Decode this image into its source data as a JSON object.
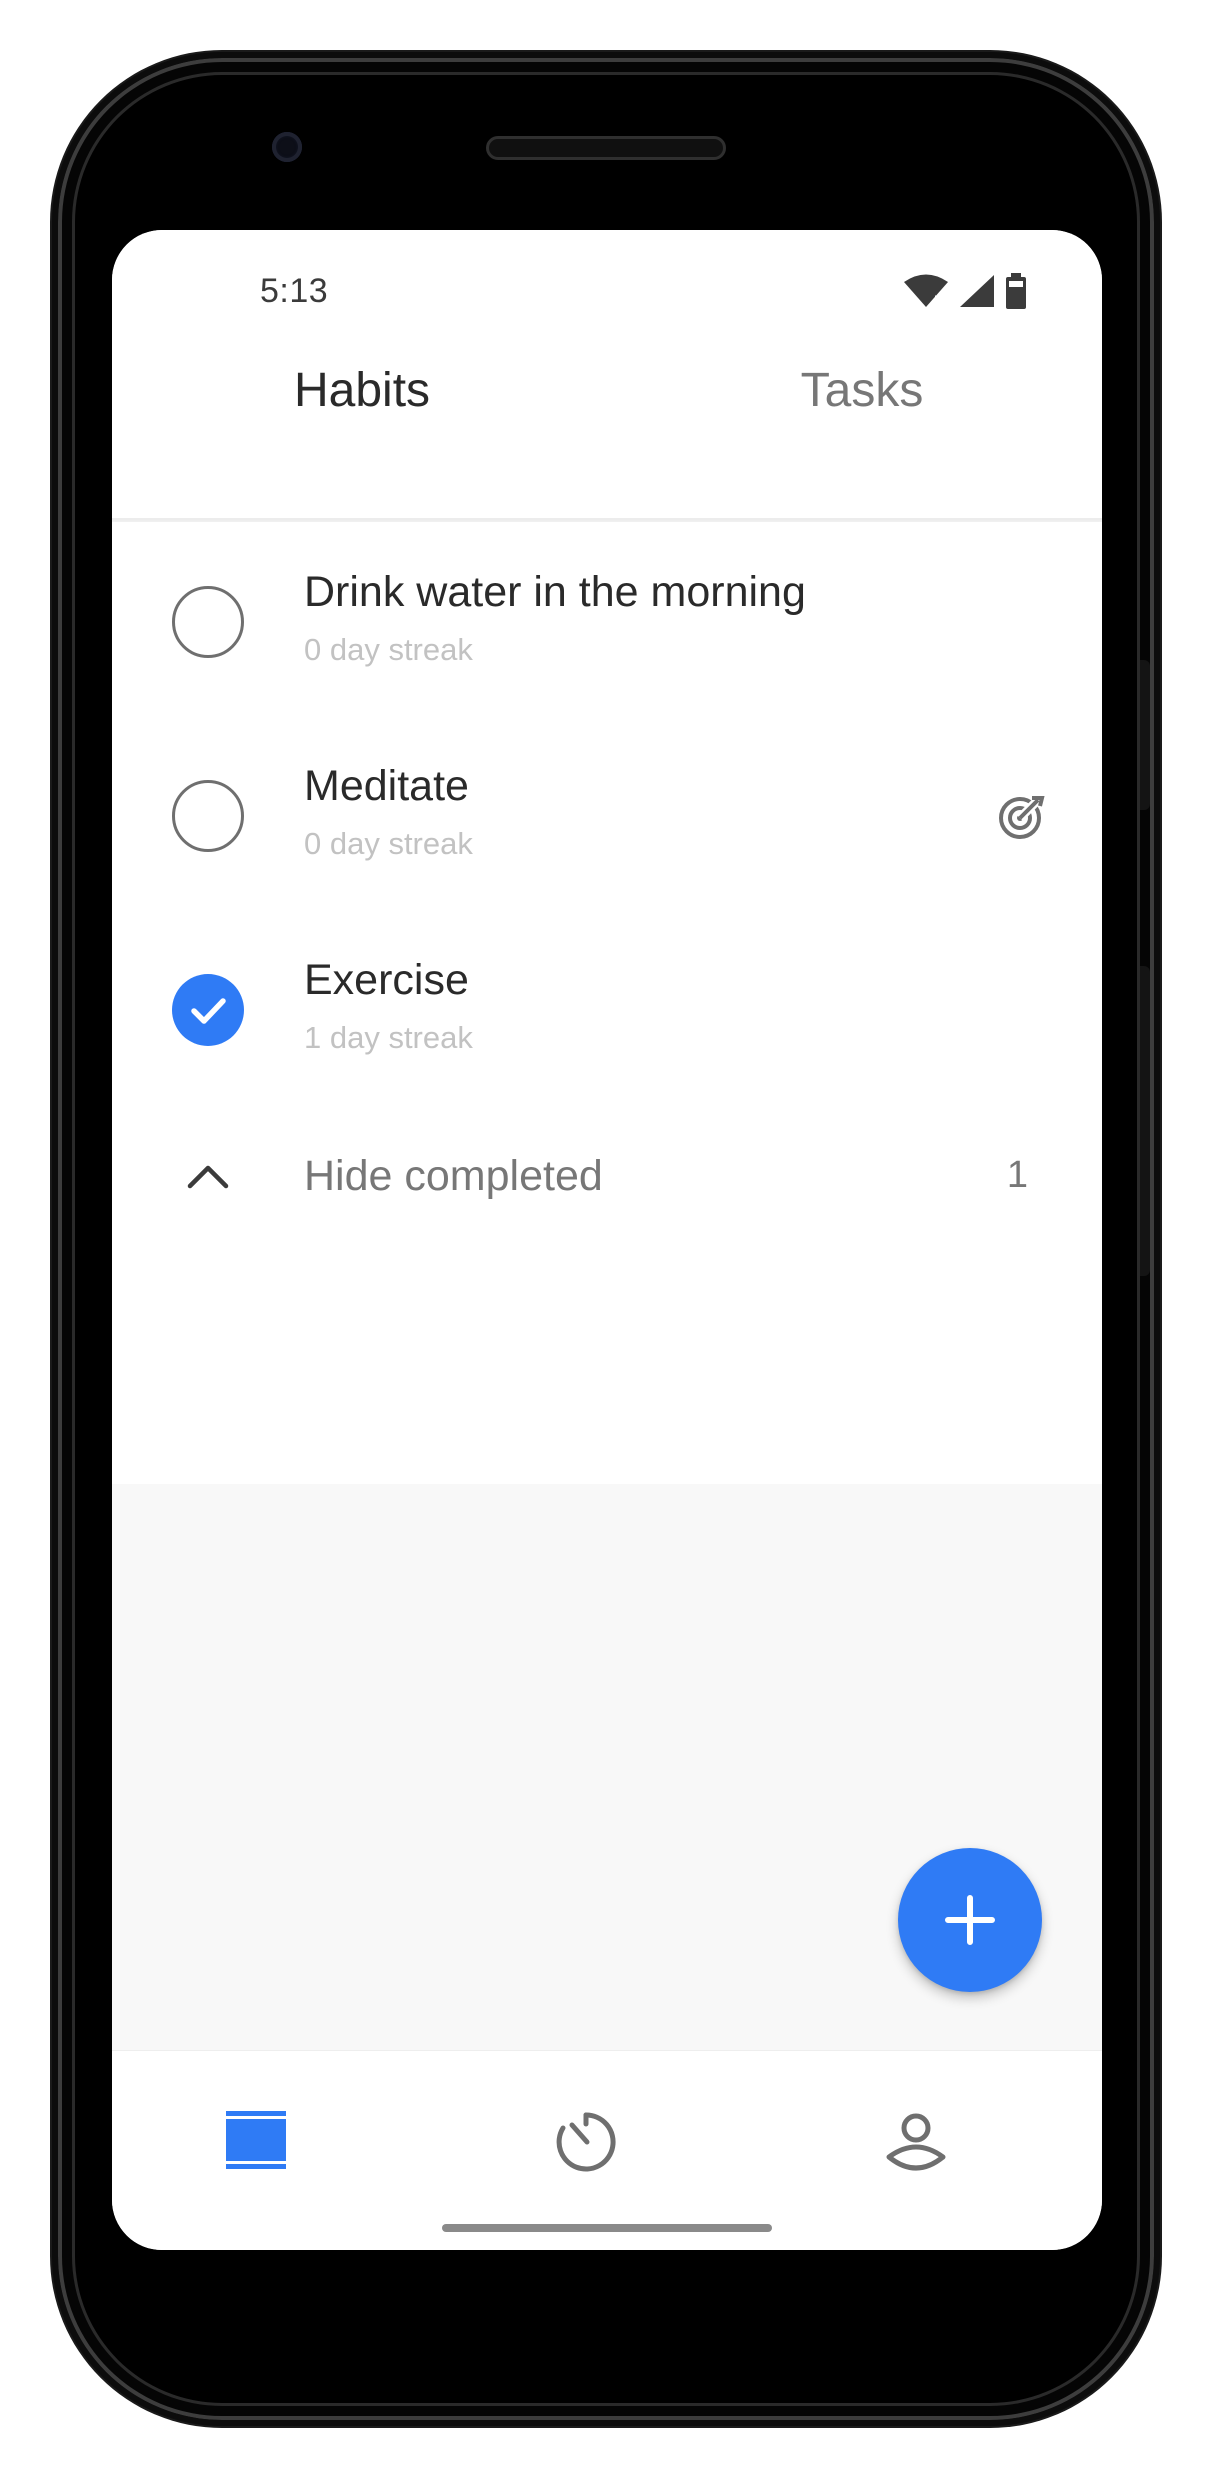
{
  "status_bar": {
    "time": "5:13",
    "icons": [
      "wifi-icon",
      "cellular-signal-icon",
      "battery-icon"
    ]
  },
  "tabs": [
    {
      "label": "Habits",
      "selected": true
    },
    {
      "label": "Tasks",
      "selected": false
    }
  ],
  "habits": [
    {
      "name": "Drink water in the morning",
      "streak": "0 day streak",
      "completed": false,
      "has_goal": false
    },
    {
      "name": "Meditate",
      "streak": "0 day streak",
      "completed": false,
      "has_goal": true
    },
    {
      "name": "Exercise",
      "streak": "1 day streak",
      "completed": true,
      "has_goal": false
    }
  ],
  "completed_section": {
    "label": "Hide completed",
    "count": "1"
  },
  "fab": {
    "icon": "plus-icon"
  },
  "bottom_nav": {
    "items": [
      {
        "icon": "habits-list-icon",
        "active": true
      },
      {
        "icon": "timer-icon",
        "active": false
      },
      {
        "icon": "profile-icon",
        "active": false
      }
    ]
  },
  "colors": {
    "accent": "#2f7bf5",
    "text_primary": "#2a2a2a",
    "text_secondary": "#777777",
    "text_muted": "#c2c2c2",
    "background": "#f8f8f8"
  }
}
